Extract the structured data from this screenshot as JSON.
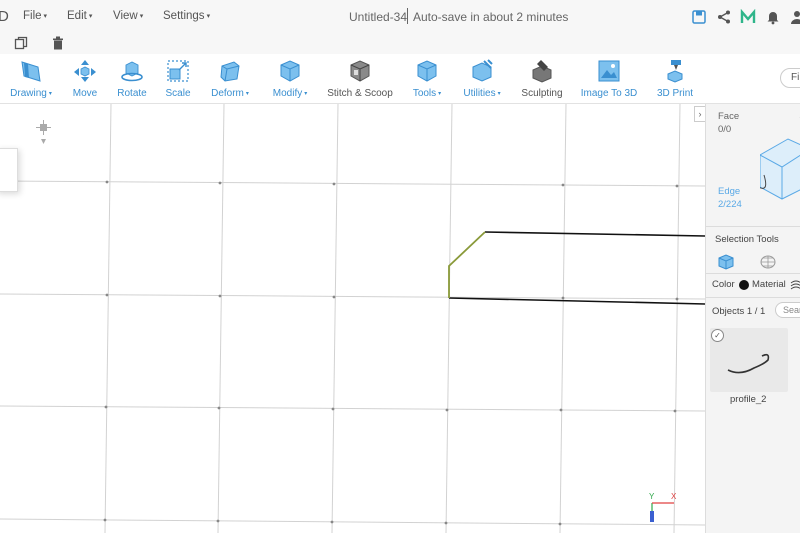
{
  "app": {
    "logo_text": "D"
  },
  "menu": {
    "file": "File",
    "edit": "Edit",
    "view": "View",
    "settings": "Settings",
    "caret": "▾"
  },
  "document": {
    "title": "Untitled-34",
    "autosave": "Auto-save in about 2 minutes"
  },
  "top_icons": [
    "save-icon",
    "share-icon",
    "m-logo-icon",
    "bell-icon",
    "user-icon"
  ],
  "sub_icons": [
    "copy-icon",
    "trash-icon"
  ],
  "toolbar": {
    "tools": [
      {
        "id": "drawing",
        "label": "Drawing",
        "dropdown": true,
        "icon": "drawing-icon"
      },
      {
        "id": "move",
        "label": "Move",
        "dropdown": false,
        "icon": "move-icon"
      },
      {
        "id": "rotate",
        "label": "Rotate",
        "dropdown": false,
        "icon": "rotate-icon"
      },
      {
        "id": "scale",
        "label": "Scale",
        "dropdown": false,
        "icon": "scale-icon"
      },
      {
        "id": "deform",
        "label": "Deform",
        "dropdown": true,
        "icon": "deform-icon"
      },
      {
        "id": "modify",
        "label": "Modify",
        "dropdown": true,
        "icon": "modify-icon"
      },
      {
        "id": "stitch",
        "label": "Stitch & Scoop",
        "dropdown": false,
        "icon": "stitch-scoop-icon"
      },
      {
        "id": "tools",
        "label": "Tools",
        "dropdown": true,
        "icon": "tools-icon"
      },
      {
        "id": "utilities",
        "label": "Utilities",
        "dropdown": true,
        "icon": "utilities-icon"
      },
      {
        "id": "sculpting",
        "label": "Sculpting",
        "dropdown": false,
        "icon": "sculpting-icon"
      },
      {
        "id": "image3d",
        "label": "Image To 3D",
        "dropdown": false,
        "icon": "image-to-3d-icon"
      },
      {
        "id": "print3d",
        "label": "3D Print",
        "dropdown": false,
        "icon": "3d-print-icon"
      }
    ],
    "find_partial": "Fi"
  },
  "viewport": {
    "collapse_glyph": "›",
    "axis": {
      "y": "Y",
      "x": "X"
    }
  },
  "right_panel": {
    "face_label": "Face",
    "face_value": "0/0",
    "edge_label": "Edge",
    "edge_value": "2/224",
    "selection_tools_title": "Selection Tools",
    "color_label": "Color",
    "material_label": "Material",
    "objects_label": "Objects 1 / 1",
    "search_placeholder": "Sear",
    "object": {
      "name": "profile_2",
      "check": "✓"
    }
  },
  "colors": {
    "accent": "#3a8fd0",
    "grid_line": "#d2d2d2",
    "profile_line": "#111111",
    "selected_edge": "#8a9a3a"
  }
}
